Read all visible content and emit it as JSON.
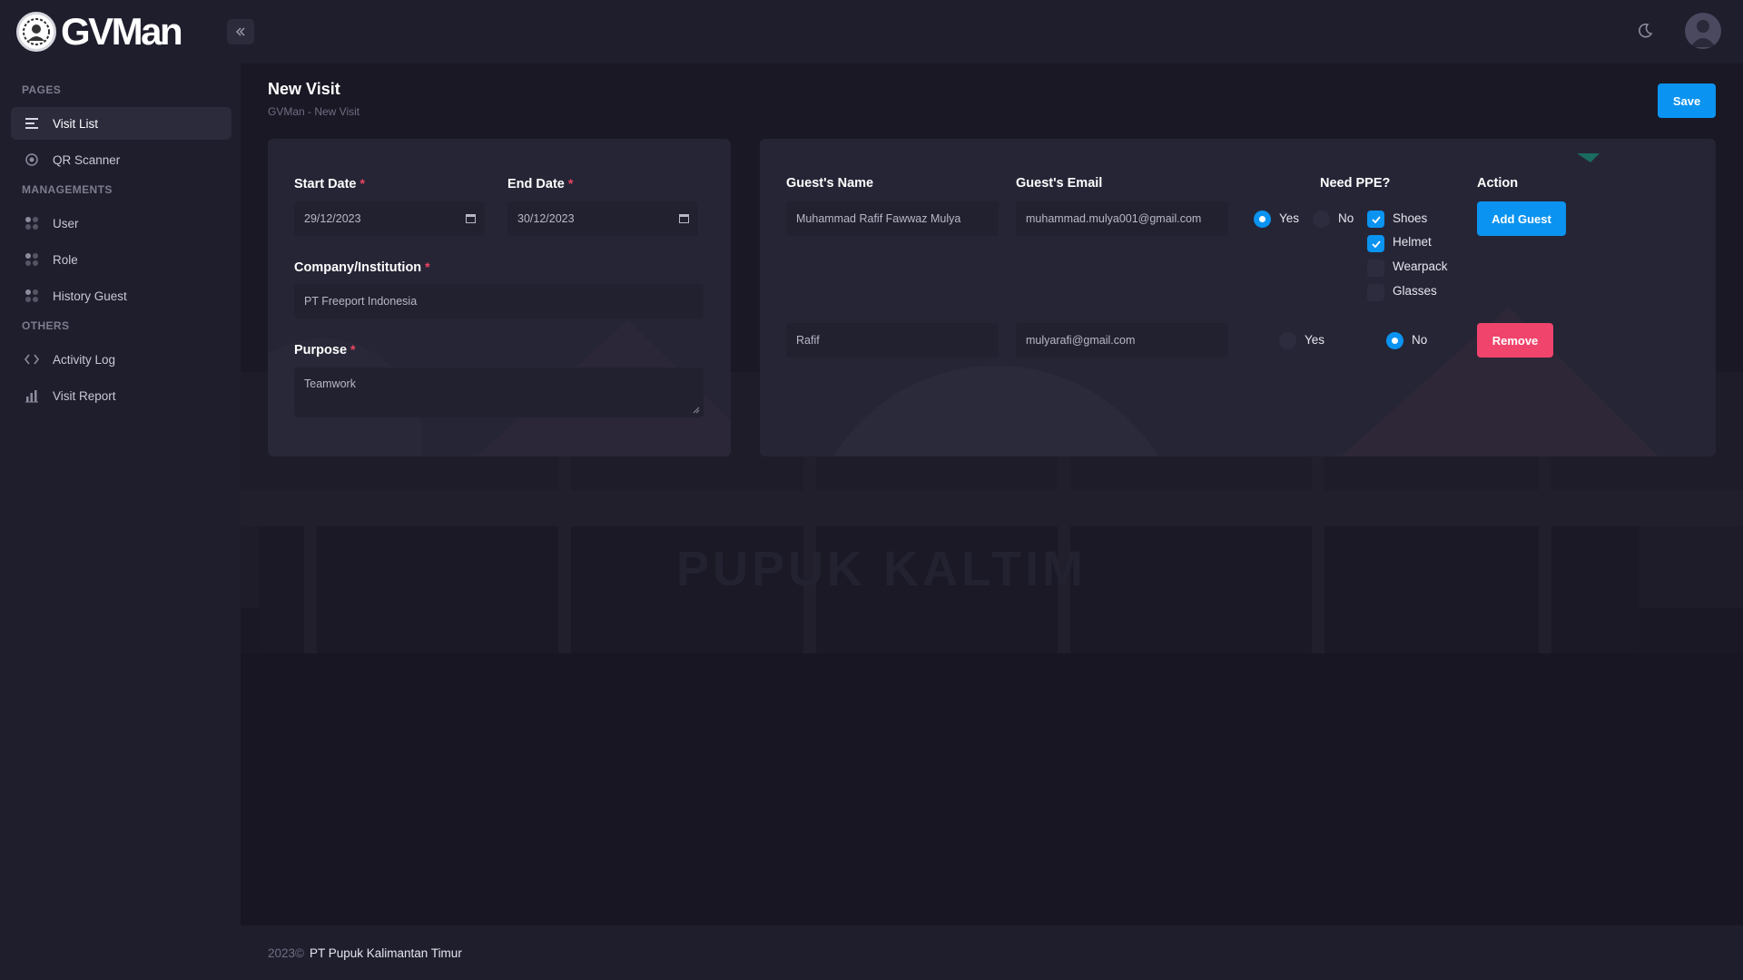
{
  "app": {
    "name": "GVMan"
  },
  "sidebar": {
    "sections": [
      {
        "title": "PAGES",
        "items": [
          {
            "label": "Visit List",
            "icon": "list-icon",
            "active": true
          },
          {
            "label": "QR Scanner",
            "icon": "qr-scanner-icon"
          }
        ]
      },
      {
        "title": "MANAGEMENTS",
        "items": [
          {
            "label": "User",
            "icon": "grid-dots-icon"
          },
          {
            "label": "Role",
            "icon": "grid-dots-icon"
          },
          {
            "label": "History Guest",
            "icon": "grid-dots-icon"
          }
        ]
      },
      {
        "title": "OTHERS",
        "items": [
          {
            "label": "Activity Log",
            "icon": "code-icon"
          },
          {
            "label": "Visit Report",
            "icon": "bar-chart-icon"
          }
        ]
      }
    ]
  },
  "page": {
    "title": "New Visit",
    "breadcrumb": "GVMan - New Visit",
    "save_label": "Save"
  },
  "form": {
    "start_date": {
      "label": "Start Date",
      "value": "29/12/2023"
    },
    "end_date": {
      "label": "End Date",
      "value": "30/12/2023"
    },
    "company": {
      "label": "Company/Institution",
      "value": "PT Freeport Indonesia"
    },
    "purpose": {
      "label": "Purpose",
      "value": "Teamwork"
    },
    "required_mark": "*"
  },
  "guests": {
    "headers": {
      "name": "Guest's Name",
      "email": "Guest's Email",
      "ppe": "Need PPE?",
      "action": "Action"
    },
    "yes_label": "Yes",
    "no_label": "No",
    "ppe_options": [
      {
        "label": "Shoes",
        "checked": true
      },
      {
        "label": "Helmet",
        "checked": true
      },
      {
        "label": "Wearpack",
        "checked": false
      },
      {
        "label": "Glasses",
        "checked": false
      }
    ],
    "rows": [
      {
        "name": "Muhammad Rafif Fawwaz Mulya",
        "email": "muhammad.mulya001@gmail.com",
        "need_ppe": "Yes",
        "action_label": "Add Guest"
      },
      {
        "name": "Rafif",
        "email": "mulyarafi@gmail.com",
        "need_ppe": "No",
        "action_label": "Remove"
      }
    ]
  },
  "background_photo_text": "PUPUK KALTIM",
  "footer": {
    "year": "2023©",
    "company": "PT Pupuk Kalimantan Timur"
  },
  "colors": {
    "accent": "#0a93f0",
    "danger": "#f0446c",
    "required": "#f04462",
    "sidebar_bg": "#1f1e2d",
    "card_bg": "#262536"
  }
}
